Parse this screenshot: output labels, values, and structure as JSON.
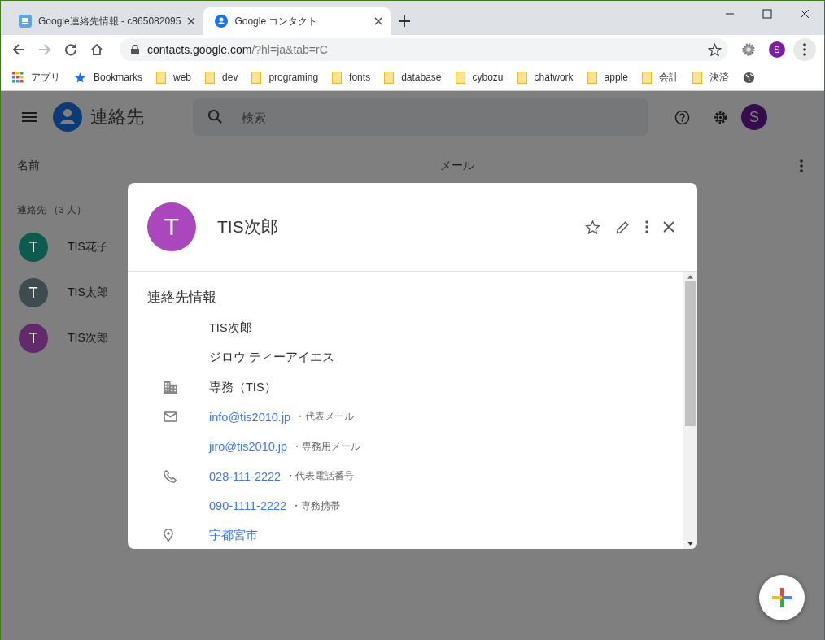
{
  "browser": {
    "tabs": [
      {
        "title": "Google連絡先情報 - c865082095",
        "selected": false
      },
      {
        "title": "Google コンタクト",
        "selected": true
      }
    ],
    "address": {
      "host": "contacts.google.com",
      "path": "/?hl=ja&tab=rC"
    },
    "profile_initial": "S",
    "bookmarks": [
      {
        "label": "アプリ",
        "kind": "apps"
      },
      {
        "label": "Bookmarks",
        "kind": "star"
      },
      {
        "label": "web",
        "kind": "folder"
      },
      {
        "label": "dev",
        "kind": "folder"
      },
      {
        "label": "programing",
        "kind": "folder"
      },
      {
        "label": "fonts",
        "kind": "folder"
      },
      {
        "label": "database",
        "kind": "folder"
      },
      {
        "label": "cybozu",
        "kind": "folder"
      },
      {
        "label": "chatwork",
        "kind": "folder"
      },
      {
        "label": "apple",
        "kind": "folder"
      },
      {
        "label": "会計",
        "kind": "folder"
      },
      {
        "label": "決済",
        "kind": "folder"
      },
      {
        "kind": "globe"
      }
    ]
  },
  "app": {
    "title": "連絡先",
    "search": {
      "placeholder": "検索"
    },
    "account_initial": "S",
    "columns": [
      "名前",
      "メール"
    ],
    "group_label": "連絡先 （3 人）",
    "contacts": [
      {
        "initial": "T",
        "name": "TIS花子",
        "color": "#0d5a4f"
      },
      {
        "initial": "T",
        "name": "TIS太郎",
        "color": "#3f4b51"
      },
      {
        "initial": "T",
        "name": "TIS次郎",
        "color": "#622a6c"
      }
    ]
  },
  "dialog": {
    "initial": "T",
    "name": "TIS次郎",
    "section_title": "連絡先情報",
    "rows": [
      {
        "kind": "none",
        "value": "TIS次郎",
        "link": false
      },
      {
        "kind": "none",
        "value": "ジロウ ティーアイエス",
        "link": false
      },
      {
        "kind": "company",
        "value": "専務（TIS）",
        "link": false
      },
      {
        "kind": "email",
        "value": "info@tis2010.jp",
        "note": "・代表メール",
        "link": true
      },
      {
        "kind": "none",
        "value": "jiro@tis2010.jp",
        "note": "・専務用メール",
        "link": true
      },
      {
        "kind": "phone",
        "value": "028-111-2222",
        "note": "・代表電話番号",
        "link": true
      },
      {
        "kind": "none",
        "value": "090-1111-2222",
        "note": "・専務携帯",
        "link": true
      },
      {
        "kind": "address",
        "value": "宇都宮市",
        "link": true
      }
    ]
  }
}
